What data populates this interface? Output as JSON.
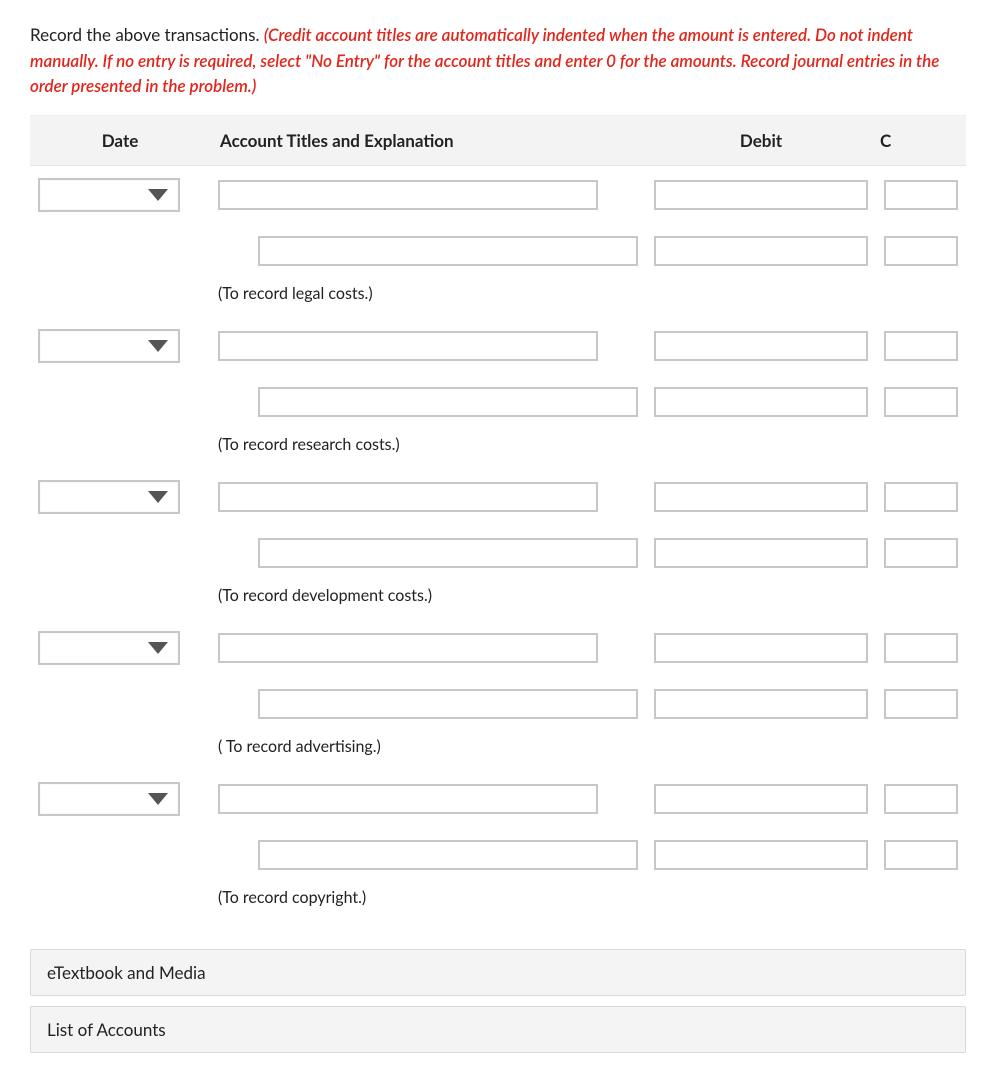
{
  "instructions_black": "Record the above transactions. ",
  "instructions_red": "(Credit account titles are automatically indented when the amount is entered. Do not indent manually. If no entry is required, select \"No Entry\" for the account titles and enter 0 for the amounts. Record journal entries in the order presented in the problem.)",
  "columns": {
    "date": "Date",
    "account": "Account Titles and Explanation",
    "debit": "Debit",
    "credit": "C"
  },
  "entries": [
    {
      "date": "",
      "debit_row": {
        "account": "",
        "debit": "",
        "credit": ""
      },
      "credit_row": {
        "account": "",
        "debit": "",
        "credit": ""
      },
      "explanation": "(To record legal costs.)"
    },
    {
      "date": "",
      "debit_row": {
        "account": "",
        "debit": "",
        "credit": ""
      },
      "credit_row": {
        "account": "",
        "debit": "",
        "credit": ""
      },
      "explanation": "(To record research costs.)"
    },
    {
      "date": "",
      "debit_row": {
        "account": "",
        "debit": "",
        "credit": ""
      },
      "credit_row": {
        "account": "",
        "debit": "",
        "credit": ""
      },
      "explanation": "(To record development costs.)"
    },
    {
      "date": "",
      "debit_row": {
        "account": "",
        "debit": "",
        "credit": ""
      },
      "credit_row": {
        "account": "",
        "debit": "",
        "credit": ""
      },
      "explanation": "( To record advertising.)"
    },
    {
      "date": "",
      "debit_row": {
        "account": "",
        "debit": "",
        "credit": ""
      },
      "credit_row": {
        "account": "",
        "debit": "",
        "credit": ""
      },
      "explanation": "(To record copyright.)"
    }
  ],
  "accordions": [
    {
      "label": "eTextbook and Media"
    },
    {
      "label": "List of Accounts"
    }
  ]
}
